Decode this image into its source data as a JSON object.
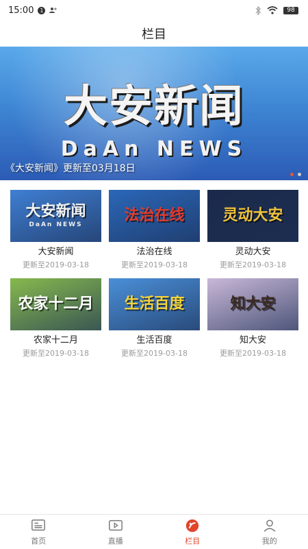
{
  "status_bar": {
    "time": "15:00",
    "notification_count": "1",
    "battery": "98"
  },
  "header": {
    "title": "栏目"
  },
  "banner": {
    "title_text": "大安新闻",
    "subtitle_text": "DaAn NEWS",
    "caption": "《大安新闻》更新至03月18日",
    "page_count": 2,
    "active_page": 0
  },
  "programs": [
    {
      "name": "大安新闻",
      "date": "更新至2019-03-18",
      "thumb_text": "大安新闻",
      "thumb_sub": "DaAn NEWS",
      "bg": "#3f7fd3",
      "fg": "#f2f2f2"
    },
    {
      "name": "法治在线",
      "date": "更新至2019-03-18",
      "thumb_text": "法治在线",
      "thumb_sub": "",
      "bg": "#2a67b8",
      "fg": "#e23b2c"
    },
    {
      "name": "灵动大安",
      "date": "更新至2019-03-18",
      "thumb_text": "灵动大安",
      "thumb_sub": "",
      "bg": "#1b2a4a",
      "fg": "#f0c23a"
    },
    {
      "name": "农家十二月",
      "date": "更新至2019-03-18",
      "thumb_text": "农家十二月",
      "thumb_sub": "",
      "bg": "#86b94e",
      "fg": "#ffffff"
    },
    {
      "name": "生活百度",
      "date": "更新至2019-03-18",
      "thumb_text": "生活百度",
      "thumb_sub": "",
      "bg": "#4a8fd8",
      "fg": "#f5d23a"
    },
    {
      "name": "知大安",
      "date": "更新至2019-03-18",
      "thumb_text": "知大安",
      "thumb_sub": "",
      "bg": "#c9b8d8",
      "fg": "#3a2a22"
    }
  ],
  "tabbar": {
    "tabs": [
      {
        "label": "首页",
        "icon": "news-icon",
        "active": false
      },
      {
        "label": "直播",
        "icon": "live-icon",
        "active": false
      },
      {
        "label": "栏目",
        "icon": "column-icon",
        "active": true
      },
      {
        "label": "我的",
        "icon": "profile-icon",
        "active": false
      }
    ]
  },
  "colors": {
    "accent": "#e0452b",
    "inactive": "#777777"
  }
}
